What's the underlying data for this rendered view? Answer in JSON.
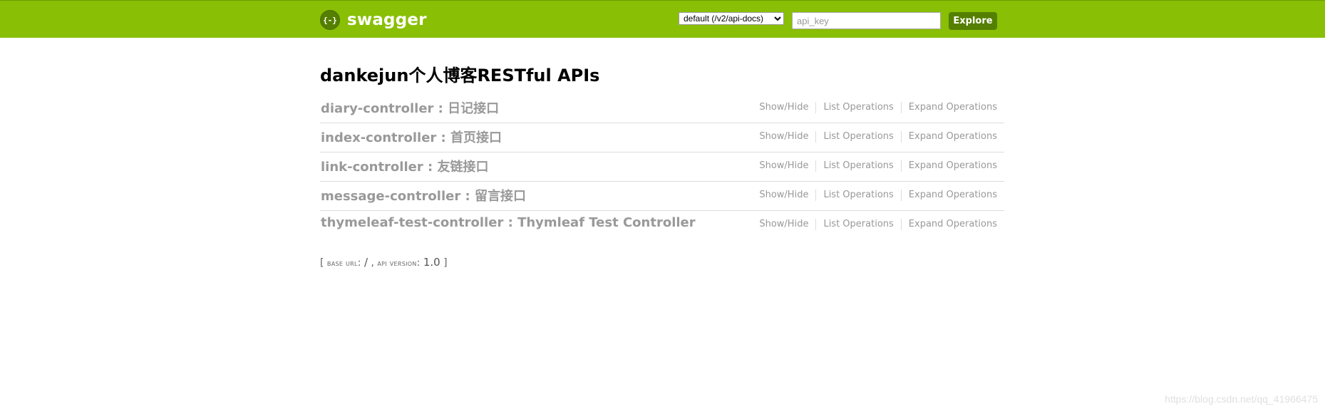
{
  "header": {
    "logo_glyph": "{-}",
    "logo_text": "swagger",
    "spec_select": {
      "selected": "default (/v2/api-docs)",
      "options": [
        "default (/v2/api-docs)"
      ]
    },
    "api_key_placeholder": "api_key",
    "explore_label": "Explore",
    "colors": {
      "bar": "#89bf04",
      "button": "#547f00"
    }
  },
  "main": {
    "title": "dankejun个人博客RESTful APIs",
    "resources": [
      {
        "name": "diary-controller : 日记接口"
      },
      {
        "name": "index-controller : 首页接口"
      },
      {
        "name": "link-controller : 友链接口"
      },
      {
        "name": "message-controller : 留言接口"
      },
      {
        "name": "thymeleaf-test-controller : Thymleaf Test Controller"
      }
    ],
    "operations": {
      "show_hide": "Show/Hide",
      "list": "List Operations",
      "expand": "Expand Operations"
    },
    "footer": {
      "open_bracket": "[ ",
      "base_url_label": "base url",
      "base_url_value": "/",
      "separator": " , ",
      "api_version_label": "api version",
      "api_version_value": "1.0",
      "close_bracket": " ]"
    }
  },
  "watermark": "https://blog.csdn.net/qq_41966475"
}
